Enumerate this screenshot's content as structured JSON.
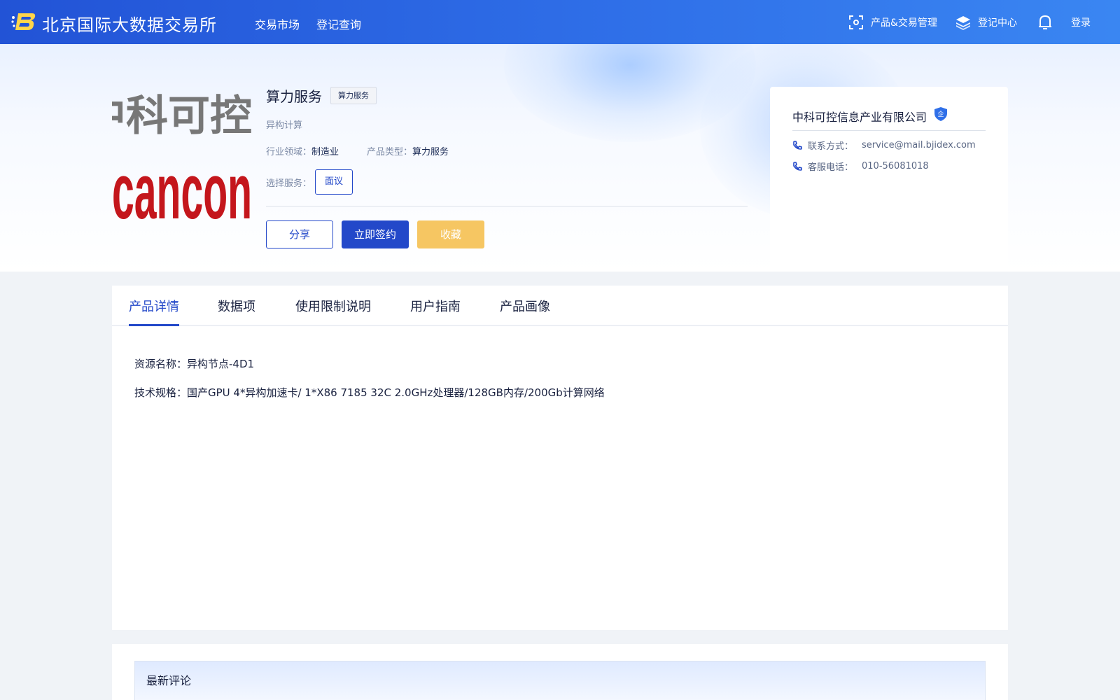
{
  "header": {
    "site_title": "北京国际大数据交易所",
    "nav": [
      "交易市场",
      "登记查询"
    ],
    "product_trade_mgmt": "产品&交易管理",
    "registration_center": "登记中心",
    "login": "登录"
  },
  "product": {
    "title": "算力服务",
    "tag": "算力服务",
    "subtitle": "异构计算",
    "industry_label": "行业领域：",
    "industry_value": "制造业",
    "type_label": "产品类型：",
    "type_value": "算力服务",
    "service_label": "选择服务：",
    "service_option": "面议",
    "logo_text_top": "中科可控",
    "logo_text_main": "cancon"
  },
  "actions": {
    "share": "分享",
    "sign": "立即签约",
    "favorite": "收藏"
  },
  "company": {
    "name": "中科可控信息产业有限公司",
    "badge": "企",
    "contact_label": "联系方式：",
    "contact_value": "service@mail.bjidex.com",
    "phone_label": "客服电话：",
    "phone_value": "010-56081018"
  },
  "tabs": [
    "产品详情",
    "数据项",
    "使用限制说明",
    "用户指南",
    "产品画像"
  ],
  "details": {
    "resource_name": "资源名称：异构节点-4D1",
    "tech_spec": "技术规格：国产GPU 4*异构加速卡/ 1*X86 7185 32C 2.0GHz处理器/128GB内存/200Gb计算网络"
  },
  "comments": {
    "title": "最新评论"
  },
  "colors": {
    "primary": "#2348c9",
    "favorite": "#f6c662",
    "header_start": "#2253d6",
    "header_end": "#3a86f2"
  }
}
